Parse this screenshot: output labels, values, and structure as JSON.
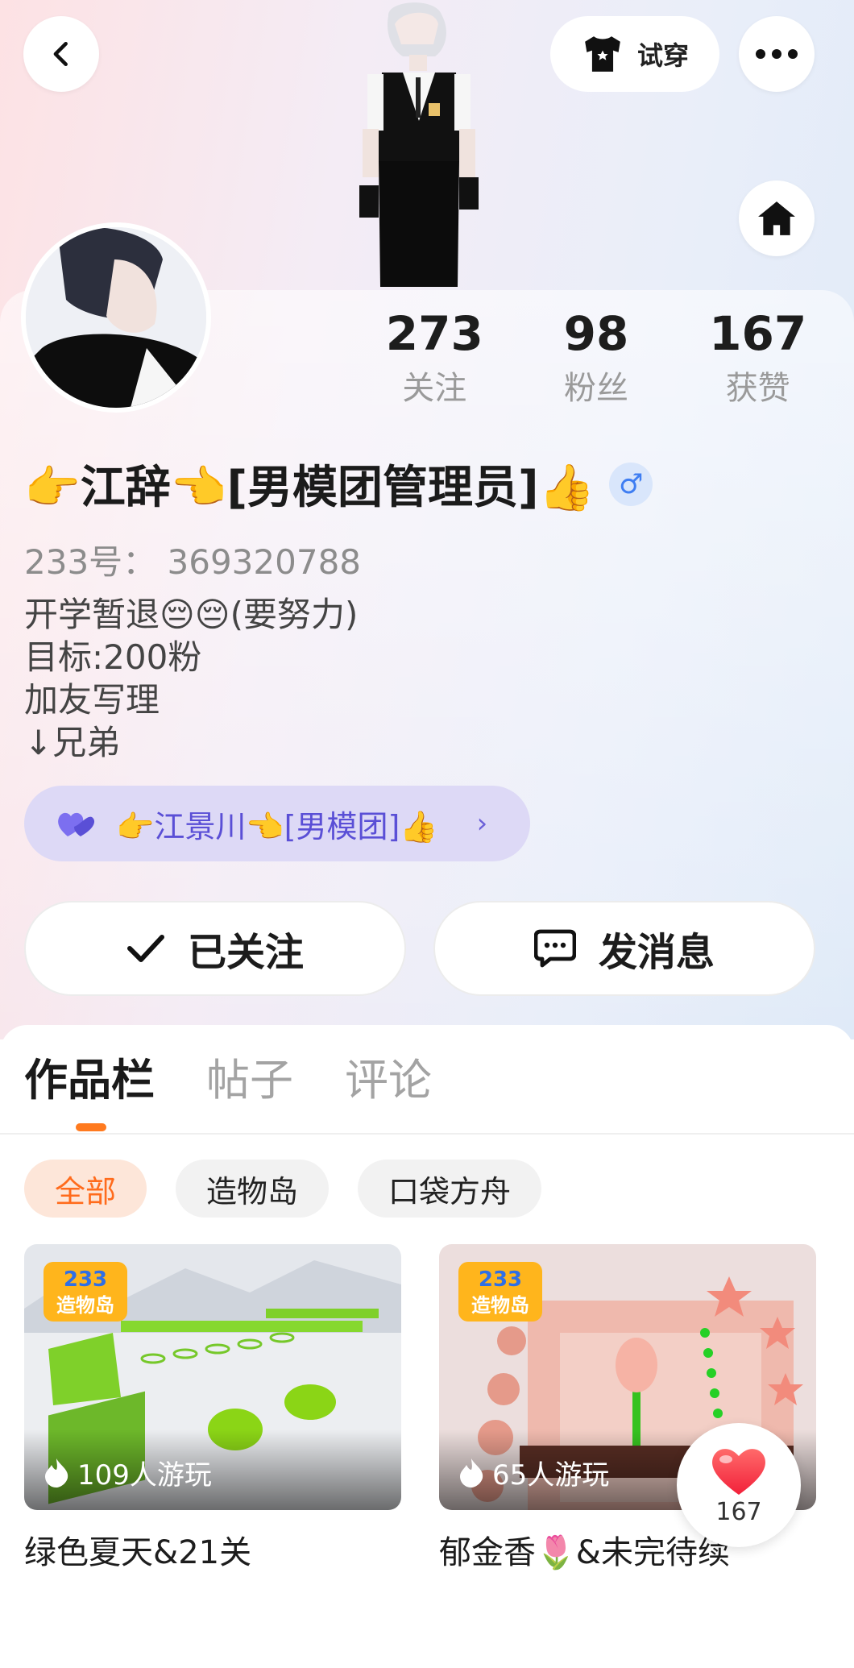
{
  "header": {
    "back_icon": "chevron-left-icon",
    "try_on_label": "试穿",
    "try_on_icon": "shirt-icon",
    "more_icon": "more-dots-icon",
    "home_icon": "home-icon"
  },
  "stats": [
    {
      "value": "273",
      "label": "关注"
    },
    {
      "value": "98",
      "label": "粉丝"
    },
    {
      "value": "167",
      "label": "获赞"
    }
  ],
  "profile": {
    "nickname": "👉江辞👈[男模团管理员]👍",
    "gender_symbol": "♂",
    "uid": "233号： 369320788",
    "bio": [
      "开学暂退😔😔(要努力)",
      "目标:200粉",
      "加友写理",
      "↓兄弟"
    ]
  },
  "partner": {
    "icon": "double-heart-icon",
    "text": "👉江景川👈[男模团]👍"
  },
  "actions": {
    "follow_label": "已关注",
    "message_label": "发消息"
  },
  "tabs": [
    "作品栏",
    "帖子",
    "评论"
  ],
  "filters": [
    "全部",
    "造物岛",
    "口袋方舟"
  ],
  "works": [
    {
      "plays": "109人游玩",
      "title": "绿色夏天&21关",
      "badge": "233造物岛"
    },
    {
      "plays": "65人游玩",
      "title": "郁金香🌷&未完待续",
      "badge": "233造物岛"
    }
  ],
  "like_float": {
    "count": "167"
  },
  "colors": {
    "accent": "#ff7a1f",
    "partner_bg": "#ddd9f6",
    "partner_text": "#5a4fd6",
    "gender": "#3f7ef2"
  }
}
